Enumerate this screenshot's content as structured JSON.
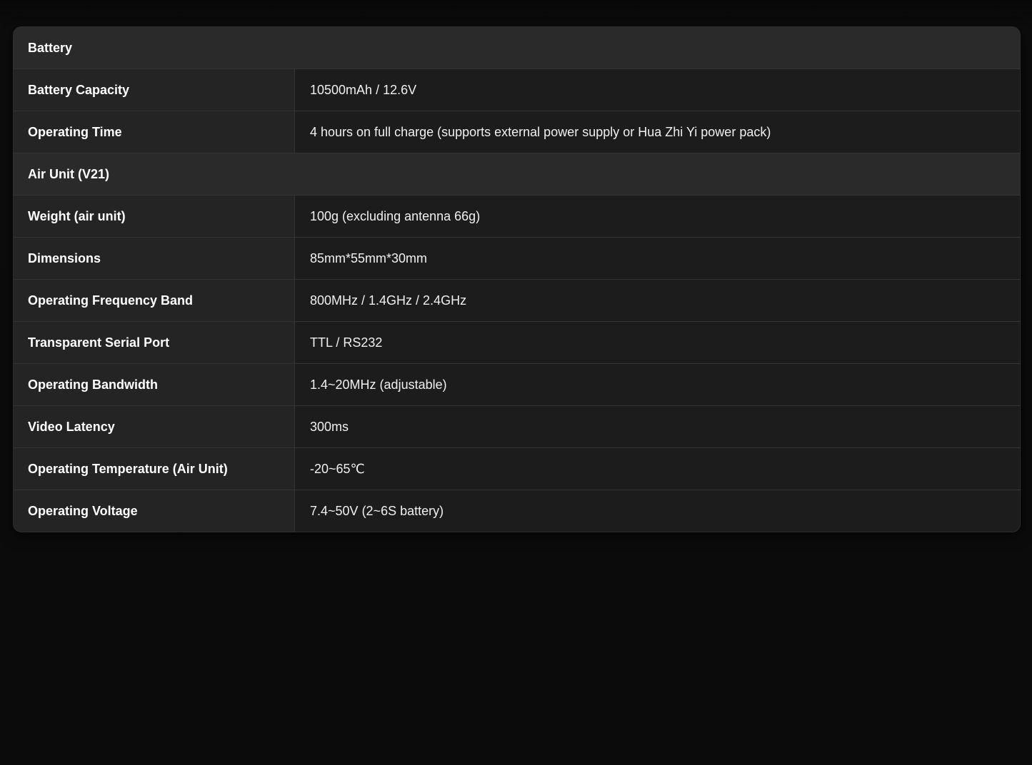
{
  "spec_table": {
    "battery_section": {
      "title": "Battery",
      "rows": [
        {
          "label": "Battery Capacity",
          "value": "10500mAh / 12.6V"
        },
        {
          "label": "Operating Time",
          "value": "4 hours on full charge (supports external power supply or Hua Zhi Yi power pack)"
        }
      ]
    },
    "air_unit_section": {
      "title": "Air Unit (V21)",
      "rows": [
        {
          "label": "Weight (air unit)",
          "value": "100g (excluding antenna 66g)"
        },
        {
          "label": "Dimensions",
          "value": "85mm*55mm*30mm"
        },
        {
          "label": "Operating Frequency Band",
          "value": "800MHz / 1.4GHz / 2.4GHz"
        },
        {
          "label": "Transparent Serial Port",
          "value": "TTL / RS232"
        },
        {
          "label": "Operating Bandwidth",
          "value": "1.4~20MHz (adjustable)"
        },
        {
          "label": "Video Latency",
          "value": "300ms"
        },
        {
          "label": "Operating Temperature (Air Unit)",
          "value": "-20~65℃"
        },
        {
          "label": "Operating Voltage",
          "value": "7.4~50V (2~6S battery)"
        }
      ]
    }
  }
}
